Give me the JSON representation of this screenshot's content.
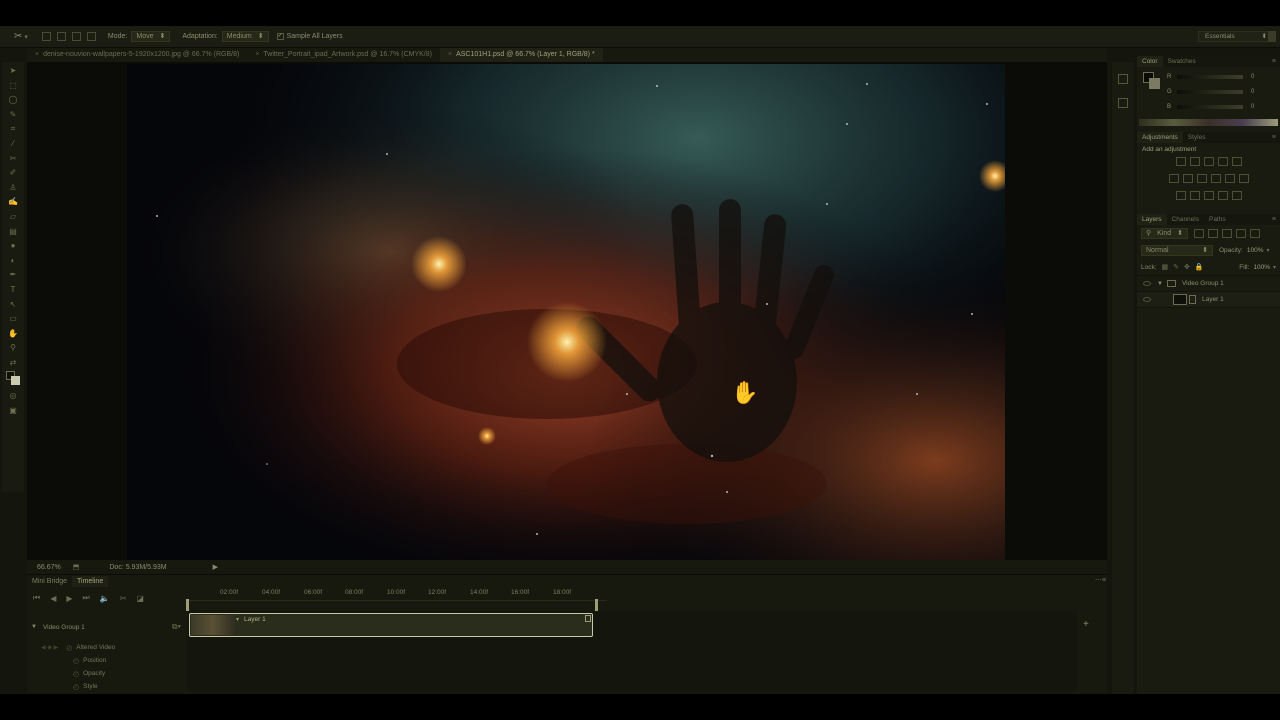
{
  "options_bar": {
    "mode_label": "Mode:",
    "mode_value": "Move",
    "adaptation_label": "Adaptation:",
    "adaptation_value": "Medium",
    "sample_all_layers": "Sample All Layers",
    "workspace": "Essentials"
  },
  "doc_tabs": [
    {
      "label": "denise-nouvion-wallpapers-5-1920x1200.jpg @ 66.7% (RGB/8)"
    },
    {
      "label": "Twitter_Portrait_ipad_Artwork.psd @ 16.7% (CMYK/8)"
    },
    {
      "label": "ASC101H1.psd @ 66.7% (Layer 1, RGB/8) *"
    }
  ],
  "status": {
    "zoom": "66.67%",
    "doc": "Doc: 5.93M/5.93M"
  },
  "timeline": {
    "tabs": [
      "Mini Bridge",
      "Timeline"
    ],
    "ticks": [
      "02:00f",
      "04:00f",
      "06:00f",
      "08:00f",
      "10:00f",
      "12:00f",
      "14:00f",
      "16:00f",
      "18:00f"
    ],
    "group_label": "Video Group 1",
    "clip_label": "Layer 1",
    "properties": [
      "Altered Video",
      "Position",
      "Opacity",
      "Style"
    ]
  },
  "color_panel": {
    "tabs": [
      "Color",
      "Swatches"
    ],
    "channels": [
      {
        "name": "R",
        "value": "0"
      },
      {
        "name": "G",
        "value": "0"
      },
      {
        "name": "B",
        "value": "0"
      }
    ]
  },
  "adjustments_panel": {
    "tabs": [
      "Adjustments",
      "Styles"
    ],
    "heading": "Add an adjustment"
  },
  "layers_panel": {
    "tabs": [
      "Layers",
      "Channels",
      "Paths"
    ],
    "kind": "Kind",
    "blend_mode": "Normal",
    "opacity_label": "Opacity:",
    "opacity_value": "100%",
    "lock_label": "Lock:",
    "fill_label": "Fill:",
    "fill_value": "100%",
    "layers": [
      {
        "name": "Video Group 1"
      },
      {
        "name": "Layer 1"
      }
    ]
  },
  "colors": {
    "app_bg": "#14160d",
    "panel_bg": "#191b10",
    "text": "#8a8a6a"
  }
}
